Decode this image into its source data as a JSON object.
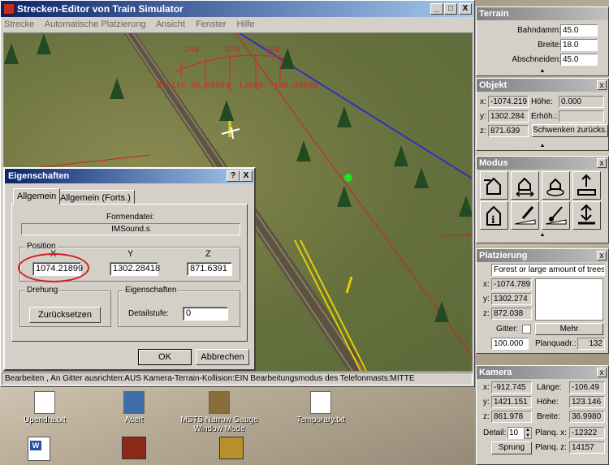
{
  "main": {
    "title": "Strecken-Editor von Train Simulator",
    "menu": [
      "Strecke",
      "Automatische Platzierung",
      "Ansicht",
      "Fenster",
      "Hilfe"
    ],
    "title_buttons": [
      "_",
      "□",
      "X"
    ],
    "scene": {
      "compass_ticks": [
        "240",
        "270",
        "300"
      ],
      "coords_text": "Breite 36.99804  Länge -106.49080"
    },
    "status": "Bearbeiten , An Gitter ausrichten:AUS Kamera-Terrain-Kollision:EIN Bearbeitungsmodus des Telefonmasts:MITTE"
  },
  "dialog": {
    "title": "Eigenschaften",
    "title_buttons": [
      "?",
      "X"
    ],
    "tabs": [
      "Allgemein",
      "Allgemein (Forts.)"
    ],
    "formendatei_label": "Formendatei:",
    "formendatei_value": "IMSound.s",
    "position_label": "Position",
    "x_label": "X",
    "y_label": "Y",
    "z_label": "Z",
    "x_value": "1074.21899",
    "y_value": "1302.28418",
    "z_value": "871.6391",
    "drehung_label": "Drehung",
    "reset_button": "Zurücksetzen",
    "eig_label": "Eigenschaften",
    "detail_label": "Detailstufe:",
    "detail_value": "0",
    "ok_button": "OK",
    "cancel_button": "Abbrechen"
  },
  "terrain": {
    "title": "Terrain",
    "bahndamm_label": "Bahndamm:",
    "bahndamm_value": "45.0",
    "breite_label": "Breite:",
    "breite_value": "18.0",
    "abschneiden_label": "Abschneiden:",
    "abschneiden_value": "45.0"
  },
  "objekt": {
    "title": "Objekt",
    "x_label": "x:",
    "x_value": "-1074.219",
    "y_label": "y:",
    "y_value": "1302.284",
    "z_label": "z:",
    "z_value": "871.639",
    "hoehe_label": "Höhe:",
    "hoehe_value": "0.000",
    "erhoeh_label": "Erhöh.:",
    "erhoeh_value": "",
    "schwenken_button": "Schwenken zurücks."
  },
  "modus": {
    "title": "Modus"
  },
  "platzierung": {
    "title": "Platzierung",
    "dropdown_value": "Forest or large amount of trees",
    "x_label": "x:",
    "x_value": "-1074.789",
    "y_label": "y:",
    "y_value": "1302.274",
    "z_label": "z:",
    "z_value": "872.038",
    "gitter_label": "Gitter:",
    "mehr_button": "Mehr",
    "gitter_value": "100.000",
    "planquadr_label": "Planquadr.:",
    "planquadr_value": "132"
  },
  "kamera": {
    "title": "Kamera",
    "x_label": "x:",
    "x_value": "-912.745",
    "y_label": "y:",
    "y_value": "1421.151",
    "z_label": "z:",
    "z_value": "861.978",
    "laenge_label": "Länge:",
    "laenge_value": "-106.49",
    "hoehe_label": "Höhe:",
    "hoehe_value": "123.146",
    "breite_label": "Breite:",
    "breite_value": "36.9980",
    "detail_label": "Detail:",
    "detail_value": "10",
    "planqx_label": "Planq. x:",
    "planqx_value": "-12322",
    "planqz_label": "Planq. z:",
    "planqz_value": "14157",
    "sprung_button": "Sprung"
  },
  "desktop": {
    "icons": [
      {
        "label": "Upendra.txt"
      },
      {
        "label": "AceIt"
      },
      {
        "label": "MSTS Narrow Gauge Window Mode"
      },
      {
        "label": "Temporary.txt"
      }
    ]
  }
}
